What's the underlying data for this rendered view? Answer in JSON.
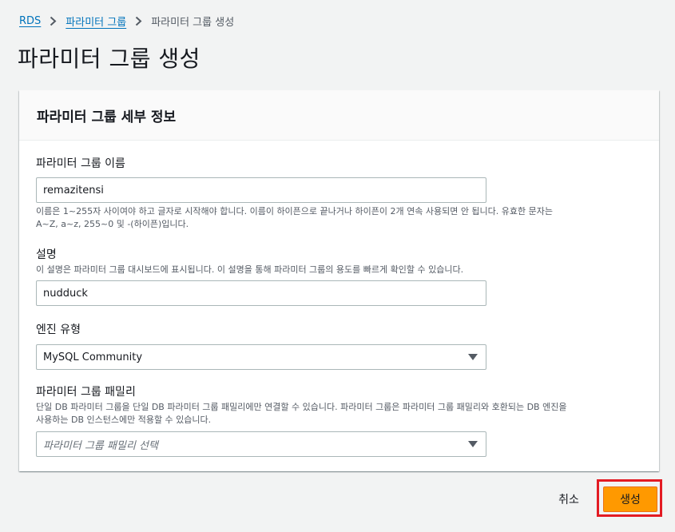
{
  "breadcrumb": {
    "items": [
      "RDS",
      "파라미터 그룹",
      "파라미터 그룹 생성"
    ]
  },
  "page_title": "파라미터 그룹 생성",
  "panel": {
    "title": "파라미터 그룹 세부 정보",
    "fields": {
      "name": {
        "label": "파라미터 그룹 이름",
        "value": "remazitensi",
        "hint_line1": "이름은 1~255자 사이여야 하고 글자로 시작해야 합니다. 이름이 하이픈으로 끝나거나 하이픈이 2개 연속 사용되면 안 됩니다. 유효한 문자는",
        "hint_line2": "A~Z, a~z, 255~0 및 -(하이픈)입니다."
      },
      "description": {
        "label": "설명",
        "hint": "이 설명은 파라미터 그룹 대시보드에 표시됩니다. 이 설명을 통해 파라미터 그룹의 용도를 빠르게 확인할 수 있습니다.",
        "value": "nudduck"
      },
      "engine_type": {
        "label": "엔진 유형",
        "selected": "MySQL Community"
      },
      "family": {
        "label": "파라미터 그룹 패밀리",
        "hint_line1": "단일 DB 파라미터 그룹을 단일 DB 파라미터 그룹 패밀리에만 연결할 수 있습니다. 파라미터 그룹은 파라미터 그룹 패밀리와 호환되는 DB 엔진을",
        "hint_line2": "사용하는 DB 인스턴스에만 적용할 수 있습니다.",
        "placeholder": "파라미터 그룹 패밀리 선택"
      }
    }
  },
  "actions": {
    "cancel_label": "취소",
    "create_label": "생성"
  },
  "colors": {
    "accent": "#ff9900",
    "link": "#0073bb",
    "highlight": "#e31b23"
  },
  "icons": {
    "breadcrumb_separator": "chevron-right-icon",
    "select_caret": "caret-down-icon"
  }
}
